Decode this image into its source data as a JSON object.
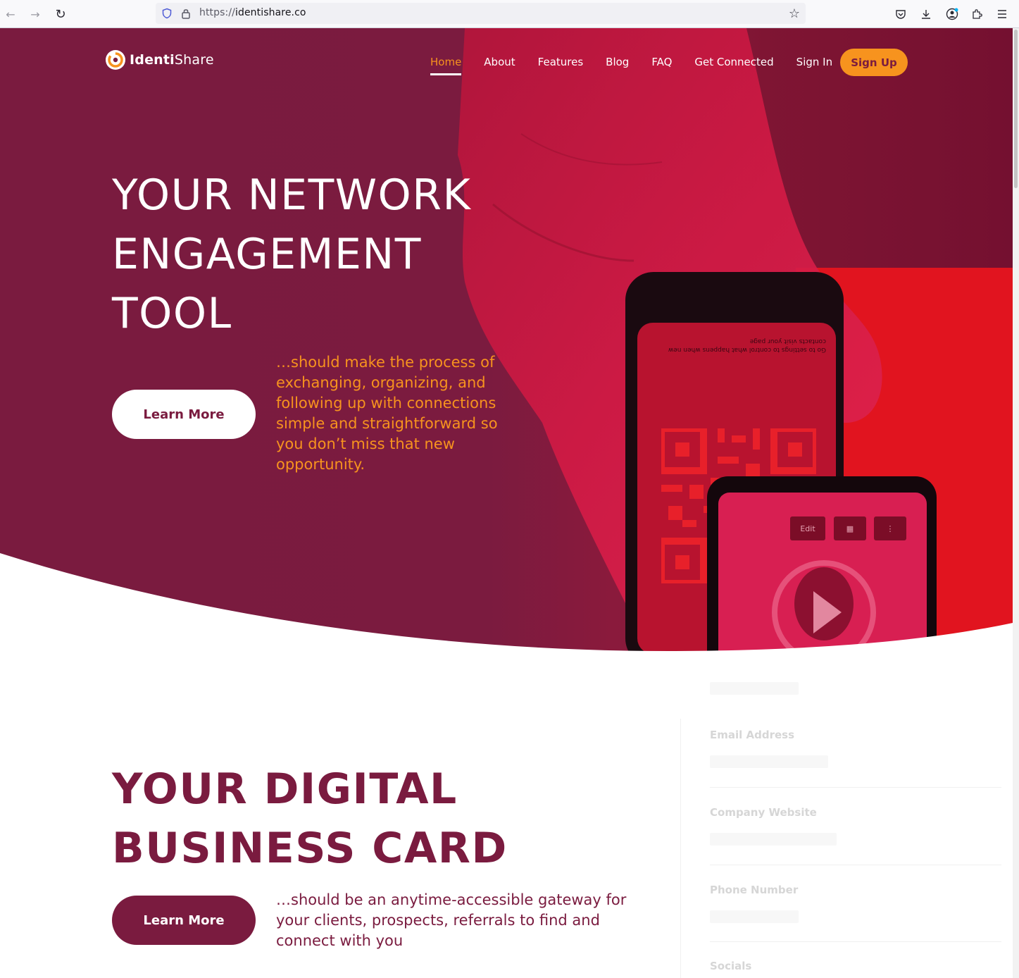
{
  "browser": {
    "url_prefix": "https://",
    "url_domain": "identishare.co"
  },
  "site": {
    "logo_bold": "Identi",
    "logo_light": "Share",
    "nav": [
      {
        "label": "Home",
        "active": true
      },
      {
        "label": "About"
      },
      {
        "label": "Features"
      },
      {
        "label": "Blog"
      },
      {
        "label": "FAQ"
      },
      {
        "label": "Get Connected"
      },
      {
        "label": "Sign In"
      }
    ],
    "signup_label": "Sign Up"
  },
  "hero": {
    "title_line1": "YOUR NETWORK",
    "title_line2": "ENGAGEMENT",
    "title_line3": "TOOL",
    "subtitle": "…should make the process of exchanging, organizing, and following up with connections simple and straightforward so you don’t miss that new opportunity.",
    "cta_label": "Learn More",
    "phone_notice": "Go to settings to control what happens when new contacts visit your page",
    "phone_edit_label": "Edit"
  },
  "section2": {
    "title_line1": "YOUR DIGITAL",
    "title_line2": "BUSINESS CARD",
    "cta_label": "Learn More",
    "subtitle": "…should be an anytime-accessible gateway for your clients, prospects, referrals to find and connect with you"
  },
  "form_mock": {
    "labels": [
      "Email Address",
      "Company Website",
      "Phone Number",
      "Socials"
    ]
  },
  "colors": {
    "brand_maroon": "#7a1b3f",
    "accent_orange": "#f7931e",
    "red": "#e1141f"
  }
}
